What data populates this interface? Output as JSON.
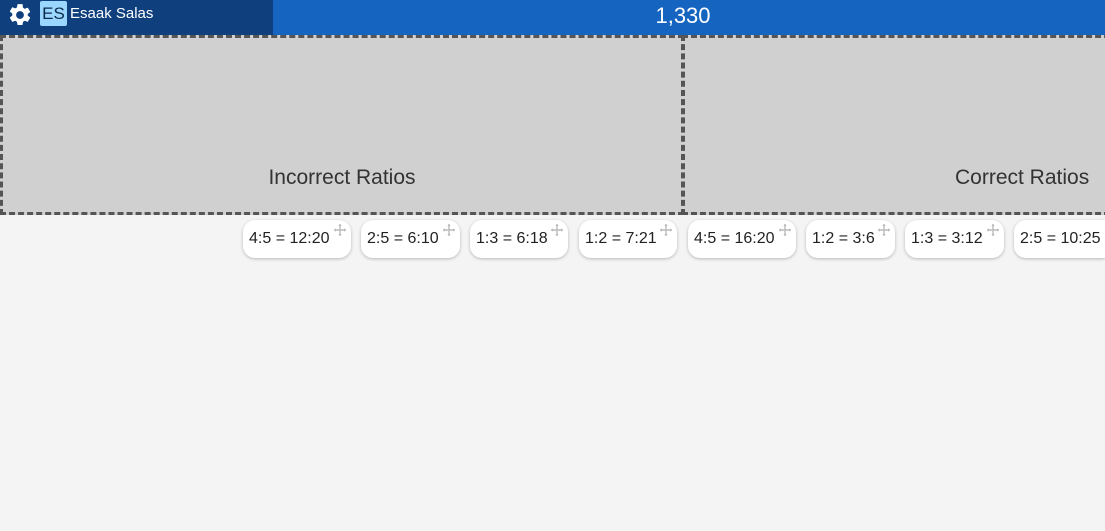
{
  "header": {
    "settings_icon": "gear-icon",
    "avatar_initials": "ES",
    "username": "Esaak Salas",
    "score": "1,330"
  },
  "dropzones": {
    "incorrect_label": "Incorrect Ratios",
    "correct_label": "Correct Ratios"
  },
  "tiles": [
    {
      "text": "4:5 = 12:20"
    },
    {
      "text": "2:5 = 6:10"
    },
    {
      "text": "1:3 = 6:18"
    },
    {
      "text": "1:2 = 7:21"
    },
    {
      "text": "4:5 = 16:20"
    },
    {
      "text": "1:2 = 3:6"
    },
    {
      "text": "1:3 = 3:12"
    },
    {
      "text": "2:5 = 10:25"
    }
  ],
  "colors": {
    "header_bg": "#1464c0",
    "user_area_bg": "#0f3f7d",
    "avatar_bg": "#9ad6ff",
    "dropzone_bg": "#d0d0d0",
    "page_bg": "#f4f4f4"
  }
}
